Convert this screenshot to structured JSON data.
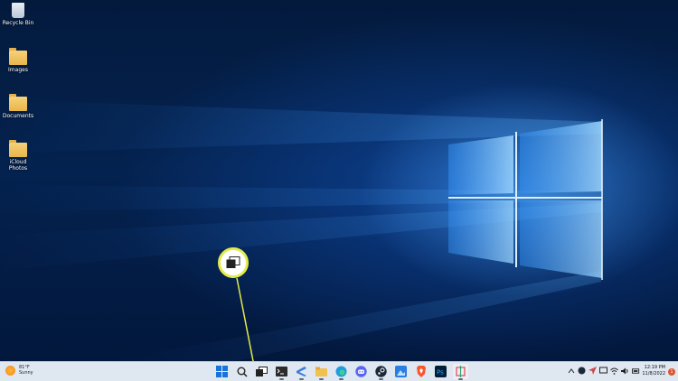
{
  "desktop": {
    "icons": [
      {
        "label": "Recycle Bin",
        "icon": "recycle-bin-icon"
      },
      {
        "label": "Images",
        "icon": "folder-icon"
      },
      {
        "label": "Documents",
        "icon": "folder-icon"
      },
      {
        "label": "iCloud Photos",
        "icon": "folder-icon"
      }
    ]
  },
  "callout": {
    "icon": "task-view-icon",
    "accent": "#e2ea4c"
  },
  "taskbar": {
    "weather": {
      "temp": "81°F",
      "condition": "Sunny",
      "icon": "sun-icon"
    },
    "apps": [
      {
        "name": "start",
        "icon": "windows-logo-icon"
      },
      {
        "name": "search",
        "icon": "search-icon"
      },
      {
        "name": "task-view",
        "icon": "task-view-icon"
      },
      {
        "name": "terminal",
        "icon": "terminal-icon"
      },
      {
        "name": "vscode-like",
        "icon": "code-editor-icon"
      },
      {
        "name": "file-explorer",
        "icon": "folder-icon"
      },
      {
        "name": "edge",
        "icon": "edge-icon"
      },
      {
        "name": "discord",
        "icon": "discord-icon"
      },
      {
        "name": "steam",
        "icon": "steam-icon"
      },
      {
        "name": "photos",
        "icon": "photos-icon"
      },
      {
        "name": "brave",
        "icon": "brave-icon"
      },
      {
        "name": "photoshop",
        "icon": "photoshop-icon",
        "label": "Ps"
      },
      {
        "name": "snipping-tool",
        "icon": "snipping-tool-icon"
      }
    ],
    "tray": [
      "chevron-up-icon",
      "steam-tray-icon",
      "send-icon",
      "display-icon",
      "wifi-icon",
      "volume-icon",
      "battery-icon"
    ],
    "clock": {
      "time": "12:19 PM",
      "date": "11/8/2022"
    },
    "notifications": "1"
  },
  "colors": {
    "taskbar_bg": "#dfe7f1",
    "desktop_accent": "#1e6fd9"
  }
}
